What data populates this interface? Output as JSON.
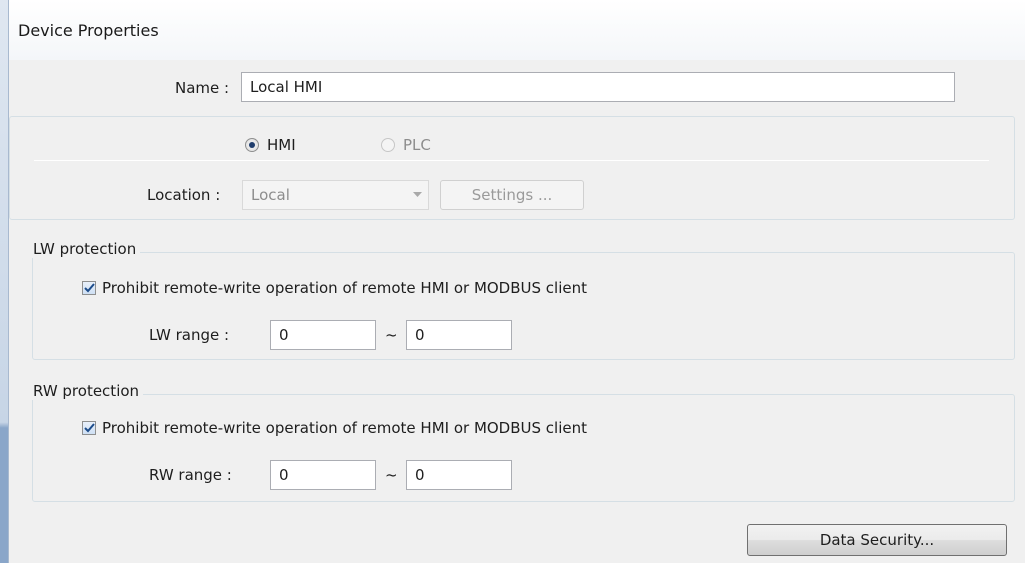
{
  "window": {
    "title": "Device Properties"
  },
  "device": {
    "name_label": "Name :",
    "name_value": "Local HMI"
  },
  "type": {
    "options": [
      {
        "label": "HMI",
        "checked": true,
        "enabled": true
      },
      {
        "label": "PLC",
        "checked": false,
        "enabled": false
      }
    ]
  },
  "location": {
    "label": "Location :",
    "selected": "Local",
    "settings_label": "Settings ..."
  },
  "lw_protection": {
    "title": "LW protection",
    "checkbox_label": "Prohibit remote-write operation of remote HMI or MODBUS client",
    "checked": true,
    "range_label": "LW range :",
    "range_from": "0",
    "range_separator": "~",
    "range_to": "0"
  },
  "rw_protection": {
    "title": "RW protection",
    "checkbox_label": "Prohibit remote-write operation of remote HMI or MODBUS client",
    "checked": true,
    "range_label": "RW range :",
    "range_from": "0",
    "range_separator": "~",
    "range_to": "0"
  },
  "footer": {
    "data_security_label": "Data Security..."
  }
}
